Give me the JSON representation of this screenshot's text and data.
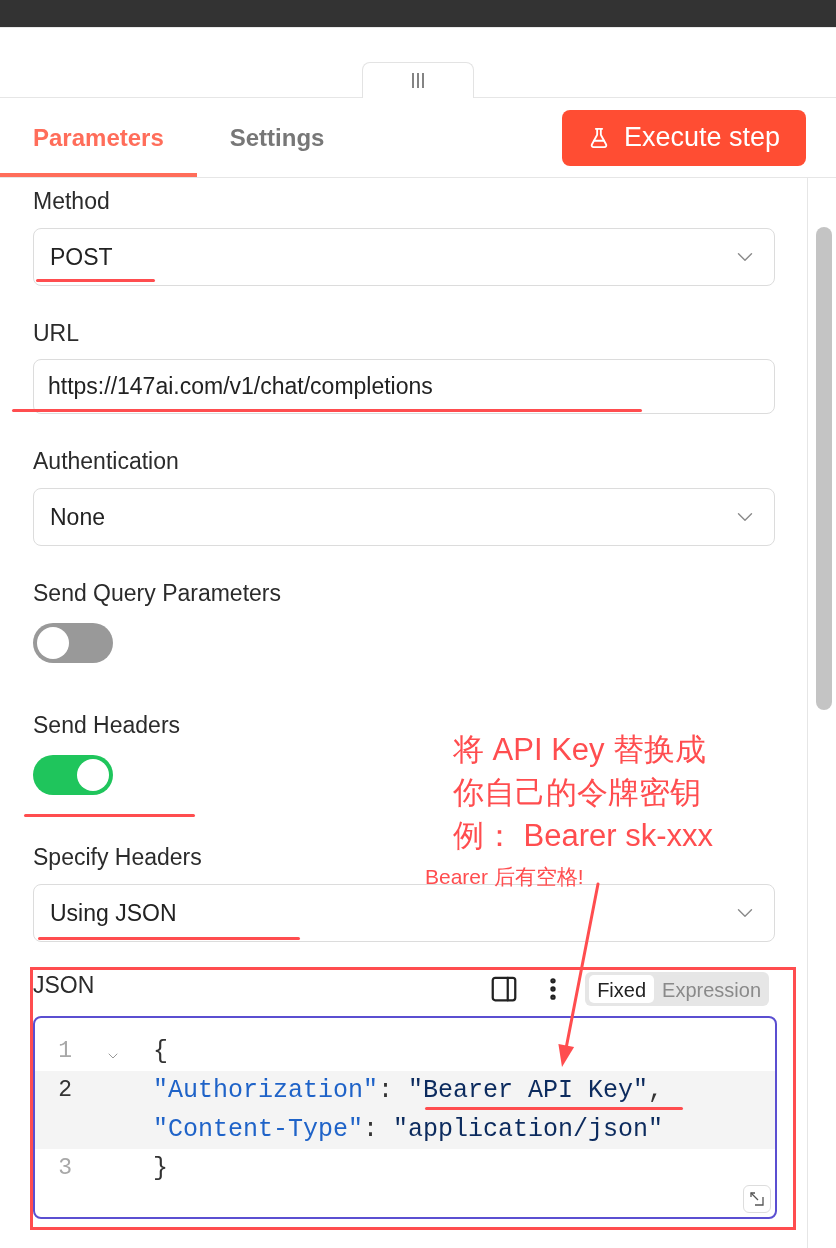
{
  "tabs": [
    {
      "label": "Parameters",
      "selected": true
    },
    {
      "label": "Settings",
      "selected": false
    }
  ],
  "execute_button": {
    "label": "Execute step"
  },
  "fields": [
    {
      "kind": "select",
      "label": "Method",
      "value": "POST"
    },
    {
      "kind": "input",
      "label": "URL",
      "value": "https://147ai.com/v1/chat/completions"
    },
    {
      "kind": "select",
      "label": "Authentication",
      "value": "None"
    },
    {
      "kind": "toggle",
      "label": "Send Query Parameters",
      "on": false
    },
    {
      "kind": "toggle",
      "label": "Send Headers",
      "on": true
    },
    {
      "kind": "select",
      "label": "Specify Headers",
      "value": "Using JSON"
    },
    {
      "kind": "code",
      "label": "JSON",
      "mode_options": [
        {
          "label": "Fixed",
          "selected": true
        },
        {
          "label": "Expression",
          "selected": false
        }
      ],
      "lines": [
        {
          "number": "1",
          "foldable": true,
          "active": false,
          "rows": [
            {
              "punct": "{"
            }
          ]
        },
        {
          "number": "2",
          "foldable": false,
          "active": true,
          "rows": [
            {
              "key": "\"Authorization\"",
              "colon": ": ",
              "value": "\"Bearer API Key\"",
              "comma": ","
            },
            {
              "key": "\"Content-Type\"",
              "colon": ": ",
              "value": "\"application/json\""
            }
          ]
        },
        {
          "number": "3",
          "foldable": false,
          "active": false,
          "rows": [
            {
              "punct": "}"
            }
          ]
        }
      ]
    }
  ],
  "annotations": {
    "note": [
      "将 API Key 替换成",
      "你自己的令牌密钥",
      "例： Bearer sk-xxx"
    ],
    "hint": "Bearer 后有空格!"
  }
}
